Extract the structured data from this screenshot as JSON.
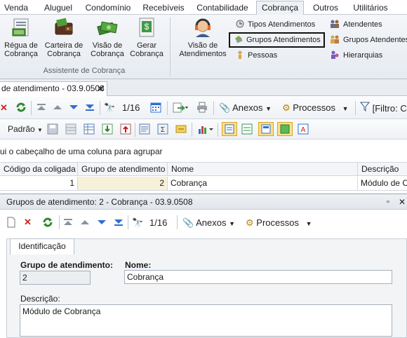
{
  "menu": {
    "tabs": [
      "Venda",
      "Aluguel",
      "Condomínio",
      "Recebíveis",
      "Contabilidade",
      "Cobrança",
      "Outros",
      "Utilitários"
    ],
    "active": "Cobrança"
  },
  "ribbon": {
    "big_buttons": [
      {
        "line1": "Régua de",
        "line2": "Cobrança",
        "icon": "ruler-doc-icon"
      },
      {
        "line1": "Carteira de",
        "line2": "Cobrança",
        "icon": "wallet-icon"
      },
      {
        "line1": "Visão de",
        "line2": "Cobrança",
        "icon": "money-icon"
      },
      {
        "line1": "Gerar",
        "line2": "Cobrança",
        "icon": "generate-doc-icon"
      },
      {
        "line1": "Visão de",
        "line2": "Atendimentos",
        "icon": "headset-icon"
      }
    ],
    "group_label": "Assistente de Cobrança",
    "small_col1": [
      "Tipos Atendimentos",
      "Grupos Atendimentos",
      "Pessoas"
    ],
    "small_col2": [
      "Atendentes",
      "Grupos Atendentes",
      "Hierarquias"
    ]
  },
  "doc_tab": {
    "title": "de atendimento - 03.9.0508",
    "close": "✕"
  },
  "toolbar1": {
    "page": "1/16",
    "attachments": "Anexos",
    "processes": "Processos",
    "filter": "[Filtro: C"
  },
  "toolbar2": {
    "default": "Padrão"
  },
  "grid": {
    "hint": "ui o cabeçalho de uma coluna para agrupar",
    "columns": [
      "Código da coligada",
      "Grupo de atendimento",
      "Nome",
      "Descrição"
    ],
    "row": [
      "1",
      "2",
      "Cobrança",
      "Módulo de Co"
    ]
  },
  "sub": {
    "title": "Grupos de atendimento: 2 - Cobrança - 03.9.0508",
    "page": "1/16",
    "attachments": "Anexos",
    "processes": "Processos",
    "tab": "Identificação",
    "group_label": "Grupo de atendimento:",
    "group_value": "2",
    "name_label": "Nome:",
    "name_value": "Cobrança",
    "desc_label": "Descrição:",
    "desc_value": "Módulo de Cobrança"
  }
}
